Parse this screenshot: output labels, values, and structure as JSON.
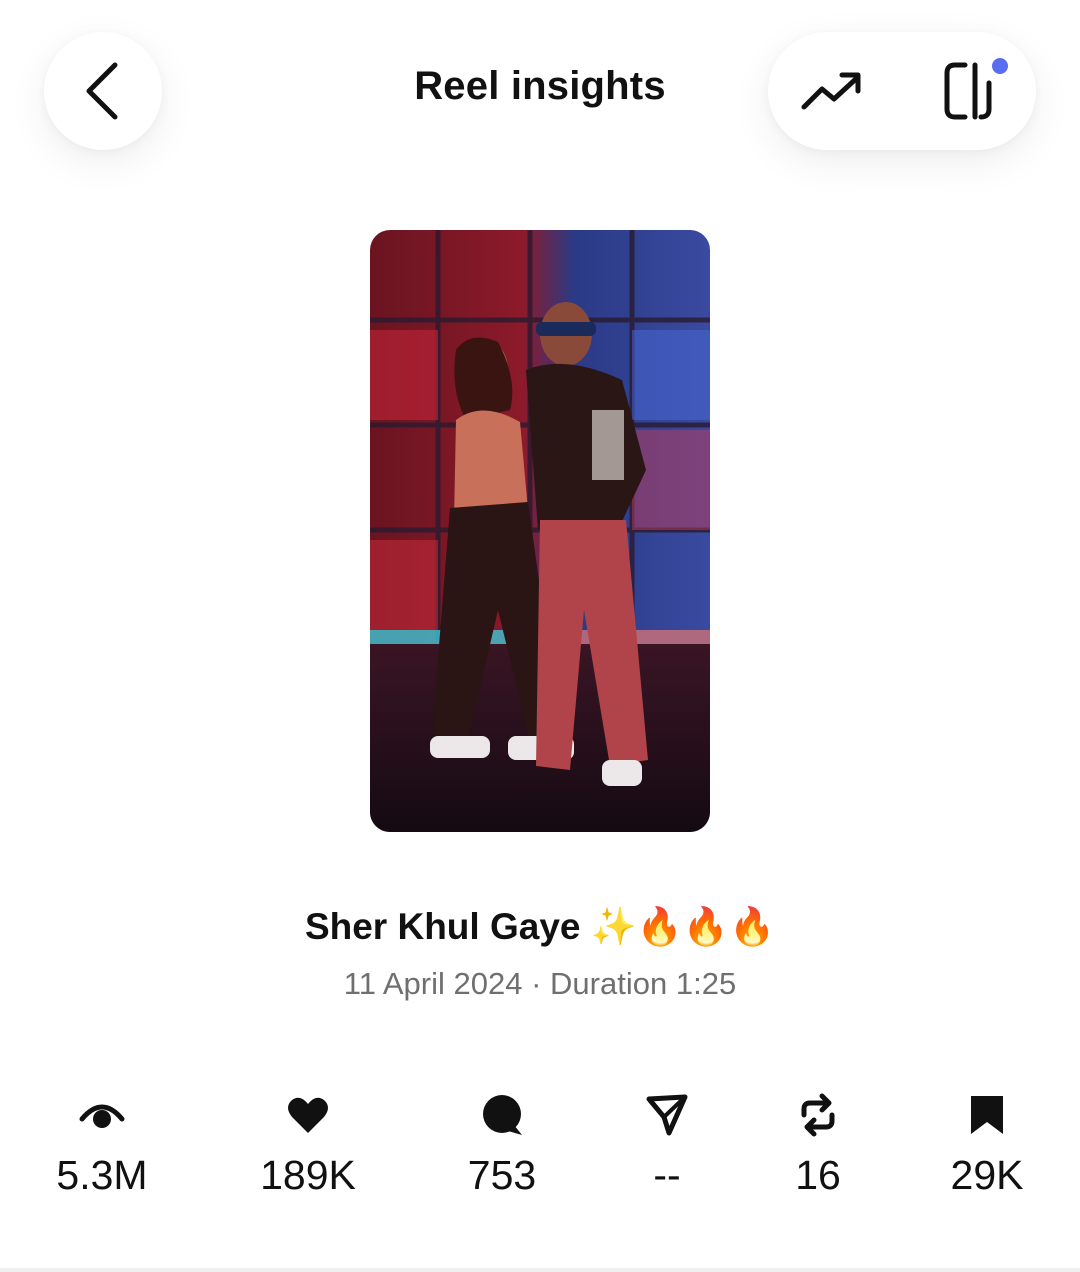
{
  "header": {
    "title": "Reel insights",
    "back_icon": "chevron-left-icon",
    "trend_icon": "trending-up-icon",
    "app_icon": "edits-app-icon",
    "notification_color": "#5a6cf0"
  },
  "reel": {
    "thumbnail": "photo of two dancers posing on a red and blue lit stage",
    "title": "Sher Khul Gaye ✨🔥🔥🔥",
    "date": "11 April 2024",
    "separator": "·",
    "duration_label": "Duration",
    "duration": "1:25"
  },
  "stats": [
    {
      "icon": "eye-icon",
      "value": "5.3M"
    },
    {
      "icon": "heart-icon",
      "value": "189K"
    },
    {
      "icon": "comment-icon",
      "value": "753"
    },
    {
      "icon": "share-icon",
      "value": "--"
    },
    {
      "icon": "repost-icon",
      "value": "16"
    },
    {
      "icon": "bookmark-icon",
      "value": "29K"
    }
  ],
  "colors": {
    "text": "#111111",
    "muted": "#6f6f6f"
  }
}
